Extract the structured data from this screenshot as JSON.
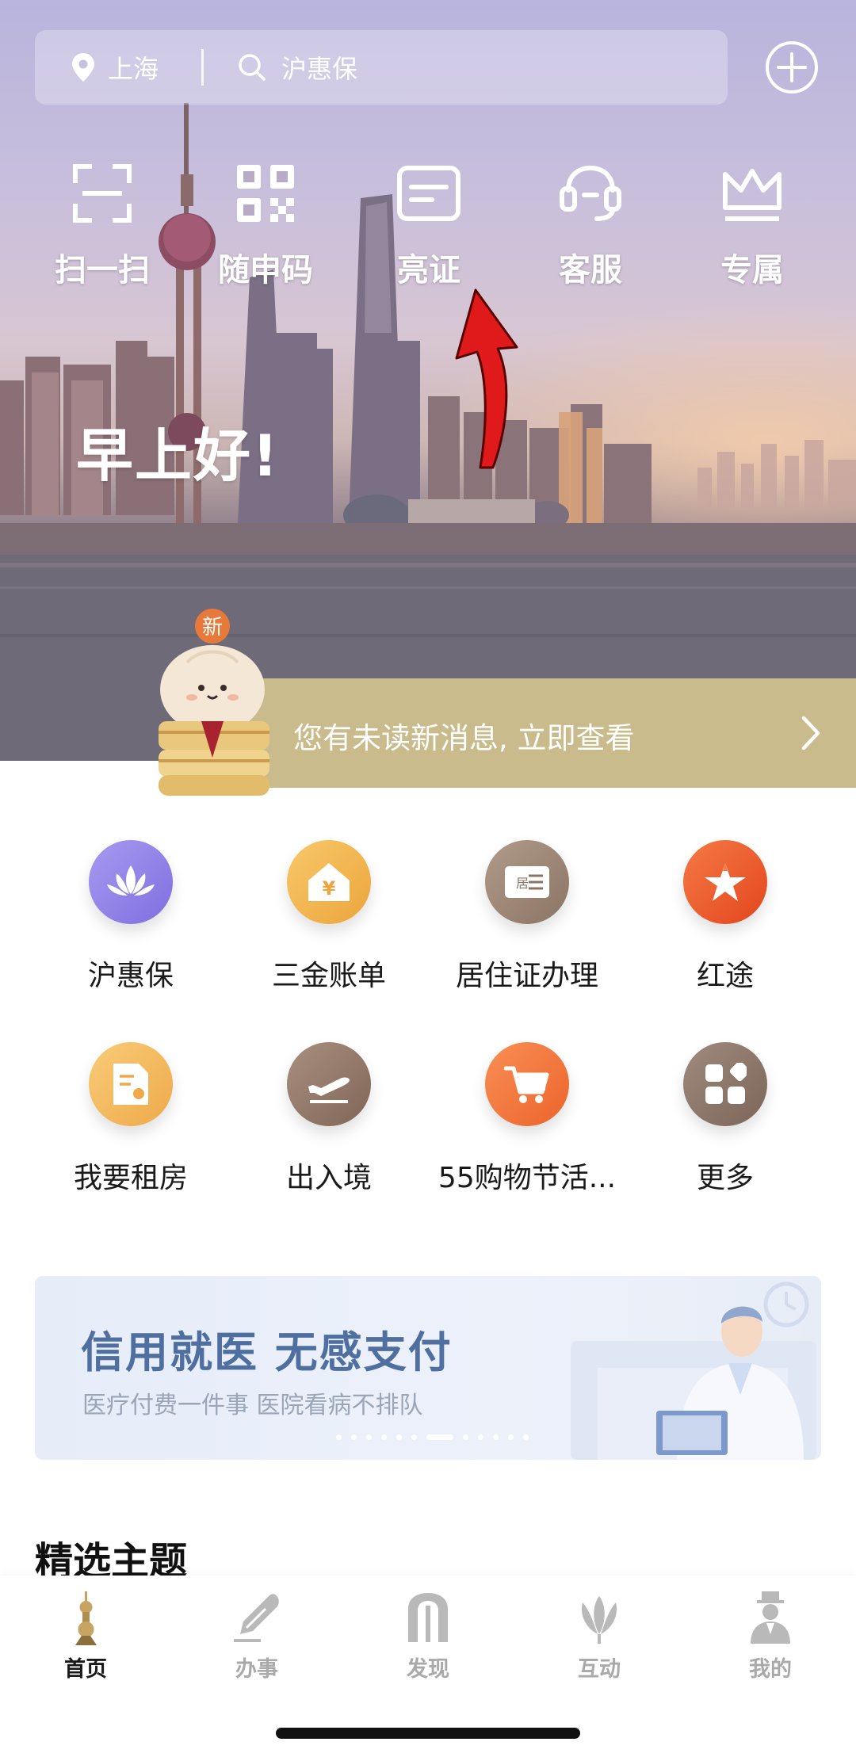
{
  "header": {
    "location": "上海",
    "search_placeholder": "沪惠保"
  },
  "quick_actions": [
    {
      "label": "扫一扫",
      "icon": "scan-icon"
    },
    {
      "label": "随申码",
      "icon": "qr-code-icon"
    },
    {
      "label": "亮证",
      "icon": "id-card-icon"
    },
    {
      "label": "客服",
      "icon": "headset-icon"
    },
    {
      "label": "专属",
      "icon": "crown-icon"
    }
  ],
  "greeting": "早上好!",
  "message_bar": {
    "badge": "新",
    "text": "您有未读新消息, 立即查看"
  },
  "services": [
    {
      "label": "沪惠保",
      "icon": "lotus-icon",
      "color": "#8d7de6"
    },
    {
      "label": "三金账单",
      "icon": "yuan-house-icon",
      "color": "#f2b64e"
    },
    {
      "label": "居住证办理",
      "icon": "residence-card-icon",
      "color": "#9c8575"
    },
    {
      "label": "红途",
      "icon": "star-flag-icon",
      "color": "#ef5f2e"
    },
    {
      "label": "我要租房",
      "icon": "rent-document-icon",
      "color": "#f5b85a"
    },
    {
      "label": "出入境",
      "icon": "airplane-icon",
      "color": "#937a6c"
    },
    {
      "label": "55购物节活...",
      "icon": "shopping-cart-icon",
      "color": "#f3773f"
    },
    {
      "label": "更多",
      "icon": "more-grid-icon",
      "color": "#8d7669"
    }
  ],
  "banner": {
    "title": "信用就医  无感支付",
    "subtitle": "医疗付费一件事 医院看病不排队",
    "slide_count": 12,
    "active_slide": 7
  },
  "section_title": "精选主题",
  "tabs": [
    {
      "label": "首页",
      "icon": "home-tower-icon",
      "active": true
    },
    {
      "label": "办事",
      "icon": "pen-icon",
      "active": false
    },
    {
      "label": "发现",
      "icon": "arch-icon",
      "active": false
    },
    {
      "label": "互动",
      "icon": "magnolia-icon",
      "active": false
    },
    {
      "label": "我的",
      "icon": "person-icon",
      "active": false
    }
  ]
}
